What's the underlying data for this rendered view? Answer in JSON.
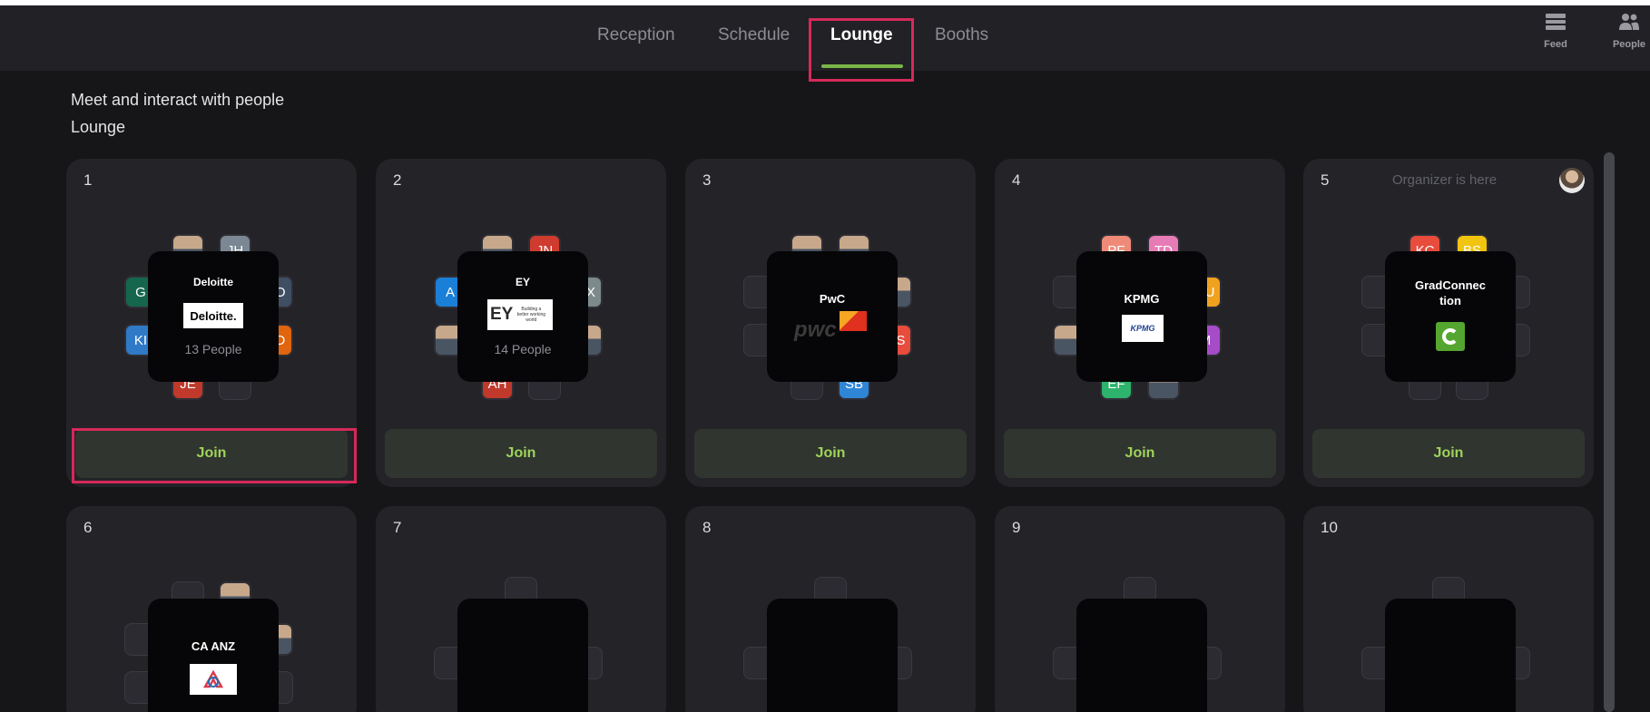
{
  "nav": {
    "tabs": [
      {
        "label": "Reception"
      },
      {
        "label": "Schedule"
      },
      {
        "label": "Lounge",
        "active": true
      },
      {
        "label": "Booths"
      }
    ],
    "right": [
      {
        "label": "Feed",
        "icon": "feed-icon"
      },
      {
        "label": "People",
        "icon": "people-icon"
      }
    ]
  },
  "page": {
    "heading": "Meet and interact with people",
    "subheading": "Lounge"
  },
  "tables": [
    {
      "number": "1",
      "name": "Deloitte",
      "logo": "Deloitte.",
      "people": "13 People",
      "join": "Join",
      "seats": [
        {
          "initials": "",
          "color": "",
          "photo": true
        },
        {
          "initials": "JH",
          "color": "#7b8793"
        },
        {
          "initials": "JO",
          "color": "#3f4f63"
        },
        {
          "initials": "JD",
          "color": "#e0650e"
        },
        {
          "initials": "JE",
          "color": "#c0392b"
        },
        {
          "initials": "KI",
          "color": "#2f79c6"
        },
        {
          "initials": "G",
          "color": "#16664d"
        }
      ]
    },
    {
      "number": "2",
      "name": "EY",
      "logo": "EY",
      "logo_tag": "Building a better working world",
      "people": "14 People",
      "join": "Join",
      "seats": [
        {
          "initials": "",
          "color": "",
          "photo": true
        },
        {
          "initials": "JN",
          "color": "#cf3b2e"
        },
        {
          "initials": "EX",
          "color": "#7d8a8c"
        },
        {
          "initials": "",
          "color": "",
          "photo": true
        },
        {
          "initials": "AH",
          "color": "#c0392b"
        },
        {
          "initials": "",
          "color": "",
          "photo": true
        },
        {
          "initials": "A",
          "color": "#1a7fd6"
        }
      ]
    },
    {
      "number": "3",
      "name": "PwC",
      "logo": "pwc",
      "join": "Join",
      "seats": [
        {
          "initials": "",
          "color": "",
          "photo": true
        },
        {
          "initials": "",
          "color": "",
          "photo": true
        },
        {
          "initials": "",
          "color": "",
          "photo": true
        },
        {
          "initials": "DS",
          "color": "#e74c3c"
        },
        {
          "initials": "SB",
          "color": "#2f86d6"
        }
      ]
    },
    {
      "number": "4",
      "name": "KPMG",
      "logo": "KPMG",
      "join": "Join",
      "seats": [
        {
          "initials": "PF",
          "color": "#f08a78"
        },
        {
          "initials": "TD",
          "color": "#e67bb5"
        },
        {
          "initials": "AU",
          "color": "#f0a21f"
        },
        {
          "initials": "M",
          "color": "#a64cc8"
        },
        {
          "initials": "",
          "color": "",
          "photo": true
        },
        {
          "initials": "EF",
          "color": "#2db36b"
        },
        {
          "initials": "",
          "color": "",
          "photo": true
        }
      ]
    },
    {
      "number": "5",
      "organizer": "Organizer is here",
      "name": "GradConnection",
      "name_line1": "GradConnec",
      "name_line2": "tion",
      "join": "Join",
      "seats": [
        {
          "initials": "KC",
          "color": "#e74c3c"
        },
        {
          "initials": "BS",
          "color": "#f1c40f"
        }
      ]
    },
    {
      "number": "6",
      "name": "CA ANZ"
    },
    {
      "number": "7"
    },
    {
      "number": "8"
    },
    {
      "number": "9"
    },
    {
      "number": "10"
    }
  ]
}
